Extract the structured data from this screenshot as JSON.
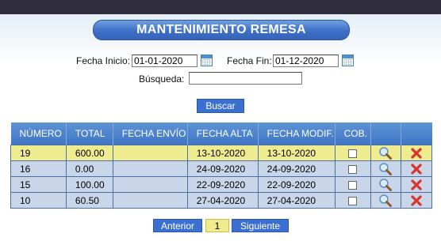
{
  "header": {
    "title": "MANTENIMIENTO REMESA"
  },
  "filters": {
    "fecha_inicio_label": "Fecha Inicio:",
    "fecha_inicio_value": "01-01-2020",
    "fecha_fin_label": "Fecha Fin:",
    "fecha_fin_value": "01-12-2020",
    "busqueda_label": "Búsqueda:",
    "busqueda_value": "",
    "buscar_label": "Buscar"
  },
  "table": {
    "columns": [
      "NÚMERO",
      "TOTAL",
      "FECHA ENVÍO",
      "FECHA ALTA",
      "FECHA MODIF.",
      "COB."
    ],
    "rows": [
      {
        "numero": "19",
        "total": "600.00",
        "fecha_envio": "",
        "fecha_alta": "13-10-2020",
        "fecha_modif": "13-10-2020",
        "cob": false,
        "selected": true
      },
      {
        "numero": "16",
        "total": "0.00",
        "fecha_envio": "",
        "fecha_alta": "24-09-2020",
        "fecha_modif": "24-09-2020",
        "cob": false,
        "selected": false
      },
      {
        "numero": "15",
        "total": "100.00",
        "fecha_envio": "",
        "fecha_alta": "22-09-2020",
        "fecha_modif": "22-09-2020",
        "cob": false,
        "selected": false
      },
      {
        "numero": "10",
        "total": "60.50",
        "fecha_envio": "",
        "fecha_alta": "27-04-2020",
        "fecha_modif": "27-04-2020",
        "cob": false,
        "selected": false
      }
    ],
    "row_icons": {
      "view": "magnifier-icon",
      "delete": "red-x-delete-icon"
    }
  },
  "pager": {
    "prev_label": "Anterior",
    "current_page": "1",
    "next_label": "Siguiente"
  },
  "colors": {
    "accent": "#3b6fd0",
    "header_bar": "#2f2c3c",
    "row_selected": "#efeb8f",
    "row_normal": "#c9d6ea",
    "delete_red": "#d9332b"
  }
}
